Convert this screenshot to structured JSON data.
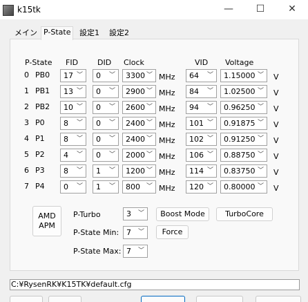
{
  "window": {
    "title": "k15tk",
    "minimize": "—",
    "maximize": "☐",
    "close": "✕"
  },
  "tabs": [
    "メイン",
    "P-State",
    "設定1",
    "設定2"
  ],
  "headers": {
    "pstate": "P-State",
    "fid": "FID",
    "did": "DID",
    "clock": "Clock",
    "vid": "VID",
    "voltage": "Voltage"
  },
  "rows": [
    {
      "idx": "0",
      "name": "PB0",
      "fid": "17",
      "did": "0",
      "clock": "3300",
      "unit": "MHz",
      "vid": "64",
      "voltage": "1.15000",
      "vunit": "V"
    },
    {
      "idx": "1",
      "name": "PB1",
      "fid": "13",
      "did": "0",
      "clock": "2900",
      "unit": "MHz",
      "vid": "84",
      "voltage": "1.02500",
      "vunit": "V"
    },
    {
      "idx": "2",
      "name": "PB2",
      "fid": "10",
      "did": "0",
      "clock": "2600",
      "unit": "MHz",
      "vid": "94",
      "voltage": "0.96250",
      "vunit": "V"
    },
    {
      "idx": "3",
      "name": "P0",
      "fid": "8",
      "did": "0",
      "clock": "2400",
      "unit": "MHz",
      "vid": "101",
      "voltage": "0.91875",
      "vunit": "V"
    },
    {
      "idx": "4",
      "name": "P1",
      "fid": "8",
      "did": "0",
      "clock": "2400",
      "unit": "MHz",
      "vid": "102",
      "voltage": "0.91250",
      "vunit": "V"
    },
    {
      "idx": "5",
      "name": "P2",
      "fid": "4",
      "did": "0",
      "clock": "2000",
      "unit": "MHz",
      "vid": "106",
      "voltage": "0.88750",
      "vunit": "V"
    },
    {
      "idx": "6",
      "name": "P3",
      "fid": "8",
      "did": "1",
      "clock": "1200",
      "unit": "MHz",
      "vid": "114",
      "voltage": "0.83750",
      "vunit": "V"
    },
    {
      "idx": "7",
      "name": "P4",
      "fid": "0",
      "did": "1",
      "clock": "800",
      "unit": "MHz",
      "vid": "120",
      "voltage": "0.80000",
      "vunit": "V"
    }
  ],
  "amd": {
    "line1": "AMD",
    "line2": "APM"
  },
  "controls": {
    "pturbo_label": "P-Turbo",
    "pturbo_value": "3",
    "pmin_label": "P-State Min:",
    "pmin_value": "7",
    "pmax_label": "P-State Max:",
    "pmax_value": "7",
    "boost_button": "Boost Mode",
    "turbocore_button": "TurboCore",
    "force_button": "Force"
  },
  "status": {
    "path": "C:¥RysenRK¥K15TK¥default.cfg"
  }
}
